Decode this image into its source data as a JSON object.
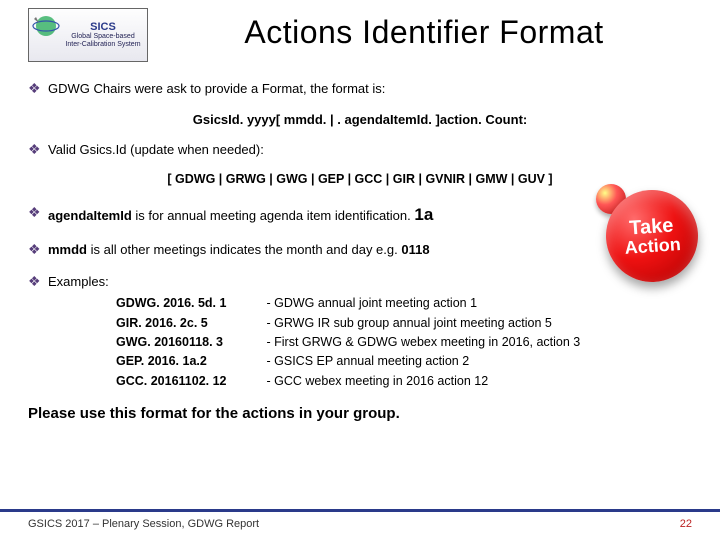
{
  "logo": {
    "line1": "SICS",
    "line2": "Global Space-based",
    "line3": "Inter-Calibration System"
  },
  "title": "Actions Identifier Format",
  "bullets": {
    "b1": "GDWG Chairs were ask to provide a Format, the format is:",
    "format_line": "GsicsId. yyyy[ mmdd. | . agendaItemId. ]action. Count:",
    "b2": "Valid Gsics.Id (update when needed):",
    "valid_line": "[ GDWG | GRWG | GWG | GEP | GCC | GIR | GVNIR | GMW | GUV ]",
    "b3_prefix": "agendaItemId",
    "b3_rest": " is for annual meeting agenda item identification. ",
    "b3_tag": "1a",
    "b4_prefix": "mmdd",
    "b4_rest": " is all other meetings indicates the month and day e.g. ",
    "b4_tag": "0118",
    "b5": "Examples:"
  },
  "examples": {
    "ids": [
      "GDWG. 2016. 5d. 1",
      "GIR. 2016. 2c. 5",
      "GWG. 20160118. 3",
      "GEP. 2016. 1a.2",
      "GCC. 20161102. 12"
    ],
    "desc": [
      "- GDWG annual joint meeting action 1",
      "- GRWG IR sub group annual joint meeting action 5",
      "- First GRWG & GDWG webex meeting in 2016, action 3",
      "- GSICS EP annual meeting action 2",
      "- GCC webex meeting in 2016 action 12"
    ]
  },
  "please": "Please use this format for the actions in your group.",
  "take_action": {
    "l1": "Take",
    "l2": "Action"
  },
  "footer": {
    "left": "GSICS 2017 – Plenary Session, GDWG Report",
    "page": "22"
  }
}
